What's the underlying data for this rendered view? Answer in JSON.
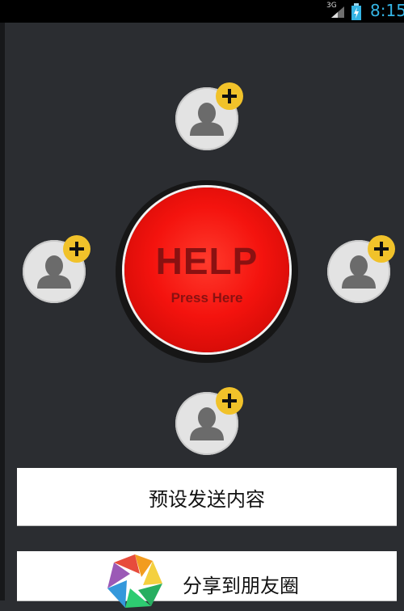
{
  "status_bar": {
    "network": "3G",
    "time": "8:15"
  },
  "help_button": {
    "title": "HELP",
    "subtitle": "Press Here"
  },
  "contacts": [
    {
      "position": "top",
      "icon": "person-icon",
      "badge_icon": "plus-icon"
    },
    {
      "position": "left",
      "icon": "person-icon",
      "badge_icon": "plus-icon"
    },
    {
      "position": "right",
      "icon": "person-icon",
      "badge_icon": "plus-icon"
    },
    {
      "position": "bottom",
      "icon": "person-icon",
      "badge_icon": "plus-icon"
    }
  ],
  "actions": {
    "preset_label": "预设发送内容",
    "share_label": "分享到朋友圈",
    "share_icon": "moments-aperture-icon"
  },
  "colors": {
    "background": "#2b2d31",
    "help_red": "#f4130e",
    "badge_yellow": "#f1c22a",
    "clock_blue": "#35b5e5"
  }
}
